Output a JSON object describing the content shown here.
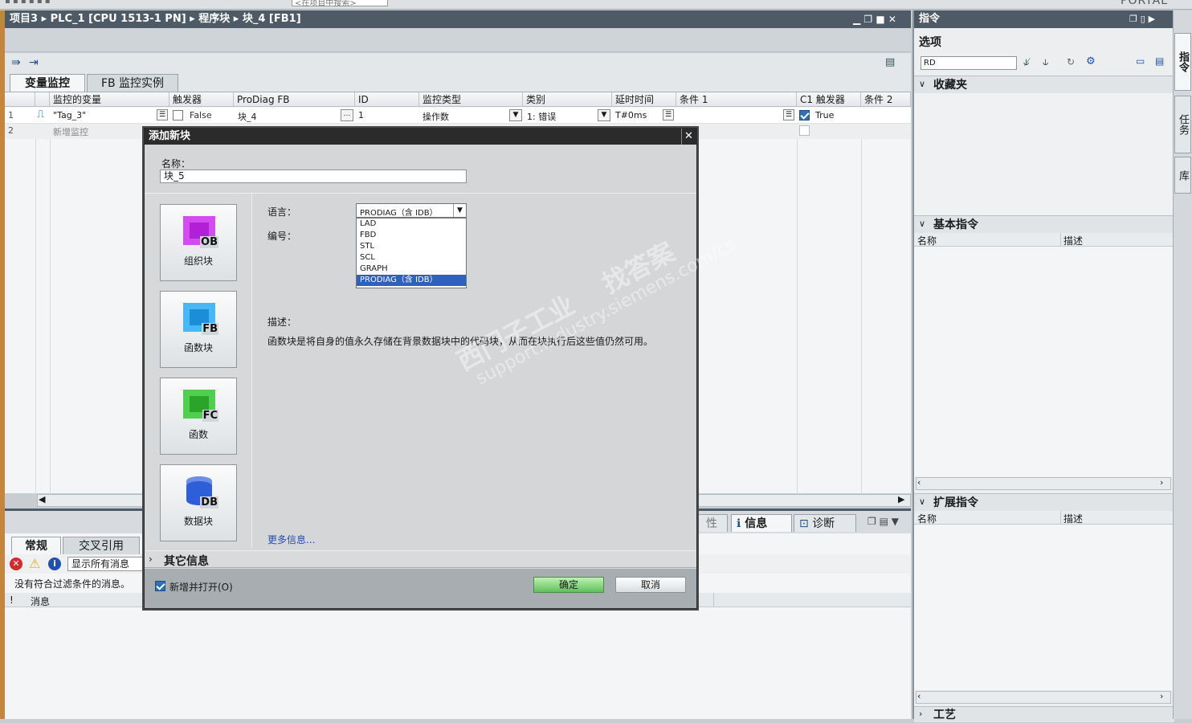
{
  "toolbar_top": {
    "search_placeholder": "<在项目中搜索>",
    "brand": "PORTAL"
  },
  "editor": {
    "breadcrumb": [
      "项目3",
      "PLC_1 [CPU 1513-1 PN]",
      "程序块",
      "块_4 [FB1]"
    ],
    "tabs": [
      "变量监控",
      "FB 监控实例"
    ],
    "table_headers": [
      "监控的变量",
      "触发器",
      "ProDiag FB",
      "ID",
      "监控类型",
      "类别",
      "延时时间",
      "条件 1",
      "C1 触发器",
      "条件 2"
    ],
    "rows": [
      {
        "num": "1",
        "variable": "\"Tag_3\"",
        "trigger": "False",
        "prodiag_fb": "块_4",
        "id": "1",
        "type": "操作数",
        "category": "1: 错误",
        "delay": "T#0ms",
        "c1_trigger": "True",
        "trigger_checked": false,
        "c1_checked": true
      },
      {
        "num": "2",
        "variable": "新增监控"
      }
    ]
  },
  "inspector": {
    "tabs_left": [
      "常规",
      "交叉引用"
    ],
    "tabs_right": [
      "性",
      "信息",
      "诊断"
    ],
    "filter_label": "显示所有消息",
    "empty_msg": "没有符合过滤条件的消息。",
    "col_msg_icon": "!",
    "col_msg": "消息"
  },
  "right_panel": {
    "title": "指令",
    "options": "选项",
    "search_value": "RD",
    "favorites": "收藏夹",
    "basic": "基本指令",
    "extended": "扩展指令",
    "technology": "工艺",
    "col_name": "名称",
    "col_desc": "描述",
    "side_tabs": [
      "指令",
      "任务",
      "库"
    ]
  },
  "dialog": {
    "title": "添加新块",
    "name_label": "名称：",
    "name_value": "块_5",
    "blocks": [
      {
        "tag": "OB",
        "label": "组织块",
        "color": "#b11fd6"
      },
      {
        "tag": "FB",
        "label": "函数块",
        "color": "#1a8fd8"
      },
      {
        "tag": "FC",
        "label": "函数",
        "color": "#2aa52a"
      },
      {
        "tag": "DB",
        "label": "数据块",
        "color": "#2f5fd8"
      }
    ],
    "language_label": "语言：",
    "number_label": "编号：",
    "language_selected": "PRODIAG（含 IDB）",
    "language_options": [
      "LAD",
      "FBD",
      "STL",
      "SCL",
      "GRAPH",
      "PRODIAG（含 IDB）"
    ],
    "desc_label": "描述：",
    "desc_text": "函数块是将自身的值永久存储在背景数据块中的代码块，从而在块执行后这些值仍然可用。",
    "more_info": "更多信息...",
    "other_info": "其它信息",
    "add_open_label": "新增并打开(O)",
    "ok": "确定",
    "cancel": "取消"
  },
  "watermark": {
    "line1": "西门子工业    找答案",
    "line2": "support.industry.siemens.com/cs"
  }
}
